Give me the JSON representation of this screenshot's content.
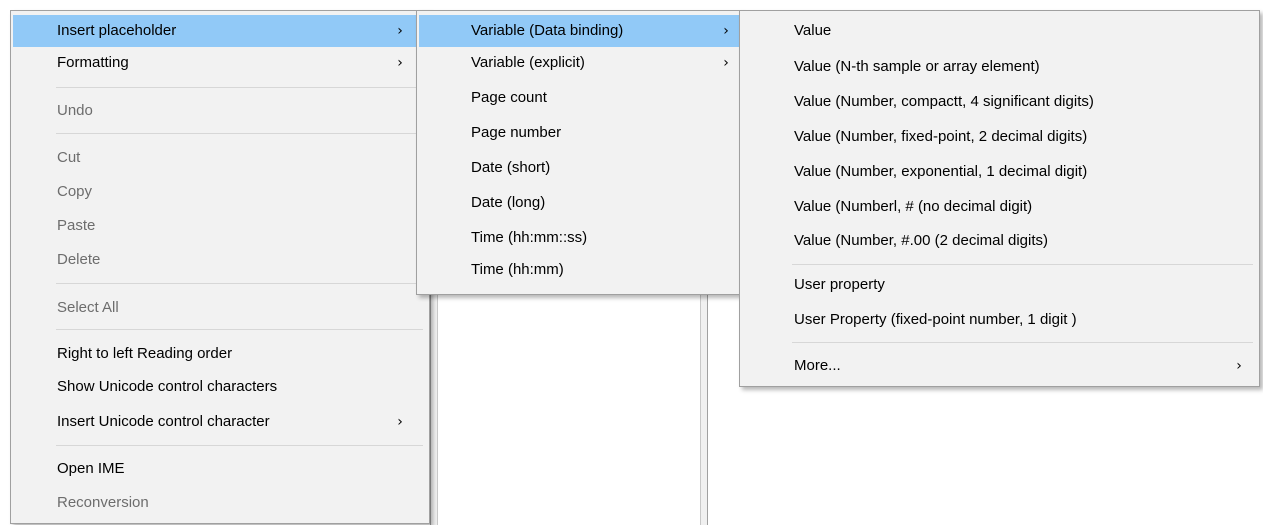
{
  "context_menu": {
    "items": [
      {
        "label": "Insert placeholder",
        "arrow": "›"
      },
      {
        "label": "Formatting",
        "arrow": "›"
      },
      {
        "label": "Undo"
      },
      {
        "label": "Cut"
      },
      {
        "label": "Copy"
      },
      {
        "label": "Paste"
      },
      {
        "label": "Delete"
      },
      {
        "label": "Select All"
      },
      {
        "label": "Right to left Reading order"
      },
      {
        "label": "Show Unicode control characters"
      },
      {
        "label": "Insert Unicode control character",
        "arrow": "›"
      },
      {
        "label": "Open IME"
      },
      {
        "label": "Reconversion"
      }
    ]
  },
  "placeholder_menu": {
    "items": [
      {
        "label": "Variable (Data binding)",
        "arrow": "›"
      },
      {
        "label": "Variable (explicit)",
        "arrow": "›"
      },
      {
        "label": "Page count"
      },
      {
        "label": "Page number"
      },
      {
        "label": "Date (short)"
      },
      {
        "label": "Date (long)"
      },
      {
        "label": "Time (hh:mm::ss)"
      },
      {
        "label": "Time (hh:mm)"
      }
    ]
  },
  "binding_menu": {
    "items": [
      {
        "label": "Value"
      },
      {
        "label": "Value (N-th sample or array element)"
      },
      {
        "label": "Value (Number, compactt, 4 significant digits)"
      },
      {
        "label": "Value (Number, fixed-point, 2 decimal digits)"
      },
      {
        "label": "Value (Number, exponential, 1 decimal digit)"
      },
      {
        "label": "Value (Numberl, # (no decimal digit)"
      },
      {
        "label": "Value (Number, #.00 (2 decimal digits)"
      },
      {
        "label": "User property"
      },
      {
        "label": "User Property (fixed-point number, 1 digit )"
      },
      {
        "label": "More...",
        "arrow": "›"
      }
    ]
  },
  "colors": {
    "menu_background": "#f2f2f2",
    "highlight": "#91c9f7",
    "disabled_text": "#6d6d6d",
    "border": "#a0a0a0"
  }
}
